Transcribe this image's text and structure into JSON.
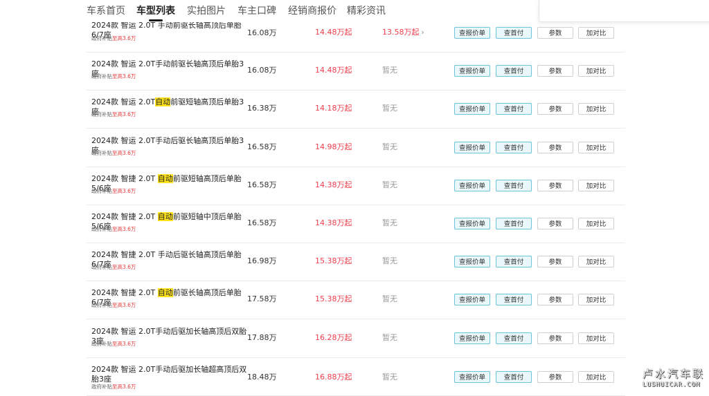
{
  "nav": {
    "tabs": [
      {
        "label": "车系首页"
      },
      {
        "label": "车型列表"
      },
      {
        "label": "实拍图片"
      },
      {
        "label": "车主口碑"
      },
      {
        "label": "经销商报价"
      },
      {
        "label": "精彩资讯"
      }
    ],
    "active_index": 1
  },
  "row_buttons": {
    "ask": "查报价单",
    "down": "查首付",
    "params": "参数",
    "compare": "加对比"
  },
  "subsidy": {
    "label": "政府补贴",
    "amount": "至高3.6万"
  },
  "rows": [
    {
      "name_pre": "2024款 智运 2.0T 手动前驱长轴高顶后单胎6/7座",
      "name_hl": "",
      "name_post": "",
      "guide": "16.08万",
      "dealer": "14.48万起",
      "used": "13.58万起",
      "used_link": true
    },
    {
      "name_pre": "2024款 智运 2.0T手动前驱长轴高顶后单胎3座",
      "name_hl": "",
      "name_post": "",
      "guide": "16.08万",
      "dealer": "14.48万起",
      "used": "暂无",
      "used_link": false
    },
    {
      "name_pre": "2024款 智运 2.0T",
      "name_hl": "自动",
      "name_post": "前驱短轴高顶后单胎3座",
      "guide": "16.38万",
      "dealer": "14.18万起",
      "used": "暂无",
      "used_link": false
    },
    {
      "name_pre": "2024款 智运 2.0T手动后驱长轴高顶后单胎3座",
      "name_hl": "",
      "name_post": "",
      "guide": "16.58万",
      "dealer": "14.98万起",
      "used": "暂无",
      "used_link": false
    },
    {
      "name_pre": "2024款 智捷 2.0T ",
      "name_hl": "自动",
      "name_post": "前驱短轴高顶后单胎5/6座",
      "guide": "16.58万",
      "dealer": "14.38万起",
      "used": "暂无",
      "used_link": false
    },
    {
      "name_pre": "2024款 智捷 2.0T ",
      "name_hl": "自动",
      "name_post": "前驱短轴中顶后单胎5/6座",
      "guide": "16.58万",
      "dealer": "14.38万起",
      "used": "暂无",
      "used_link": false
    },
    {
      "name_pre": "2024款 智捷 2.0T 手动后驱长轴高顶后单胎6/7座",
      "name_hl": "",
      "name_post": "",
      "guide": "16.98万",
      "dealer": "15.38万起",
      "used": "暂无",
      "used_link": false
    },
    {
      "name_pre": "2024款 智捷 2.0T ",
      "name_hl": "自动",
      "name_post": "前驱长轴高顶后单胎6/7座",
      "guide": "17.58万",
      "dealer": "15.38万起",
      "used": "暂无",
      "used_link": false
    },
    {
      "name_pre": "2024款 智运 2.0T手动后驱加长轴高顶后双胎3座",
      "name_hl": "",
      "name_post": "",
      "guide": "17.88万",
      "dealer": "16.28万起",
      "used": "暂无",
      "used_link": false
    },
    {
      "name_pre": "2024款 智运 2.0T手动后驱加长轴超高顶后双胎3座",
      "name_hl": "",
      "name_post": "",
      "guide": "18.48万",
      "dealer": "16.88万起",
      "used": "暂无",
      "used_link": false
    }
  ],
  "watermark": {
    "cn": "卢水汽车联",
    "en": "LUSHUICAR.COM"
  }
}
